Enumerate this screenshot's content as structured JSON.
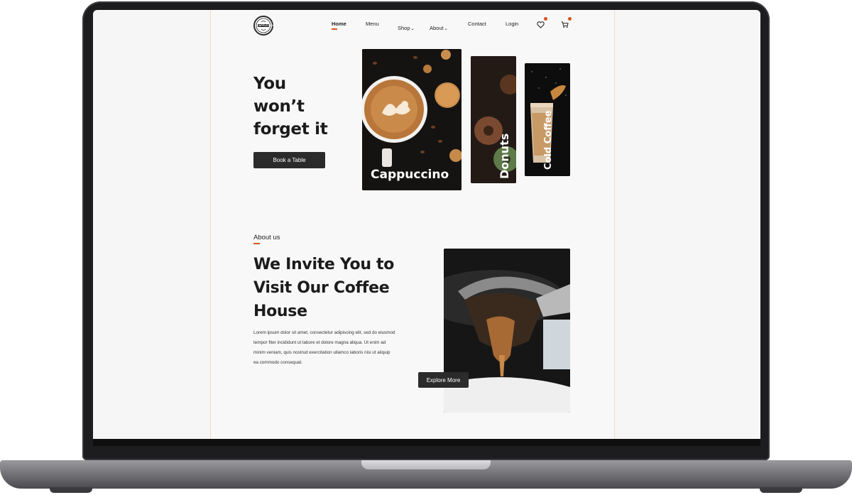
{
  "logo": {
    "text": "CAPPUCCINO"
  },
  "nav": {
    "items": [
      {
        "label": "Home",
        "active": true
      },
      {
        "label": "Menu"
      },
      {
        "label": "Shop"
      },
      {
        "label": "About"
      },
      {
        "label": "Contact"
      },
      {
        "label": "Login"
      }
    ],
    "wishlist_icon": "heart-icon",
    "cart_icon": "cart-icon"
  },
  "hero": {
    "title_lines": [
      "You",
      "won’t",
      "forget it"
    ],
    "cta": "Book a Table",
    "cards": [
      {
        "label": "Cappuccino"
      },
      {
        "label": "Donuts"
      },
      {
        "label": "Cold Coffee"
      }
    ]
  },
  "about": {
    "kicker": "About us",
    "title_lines": [
      "We Invite You to",
      "Visit Our Coffee",
      "House"
    ],
    "body_lines": [
      "Lorem ipsum dolor sit amet, consectetur adipiscing elit, sed do eiusmod",
      "tempor fiter incididunt ut labore et dolore magna aliqua. Ut enim ad",
      "minim veniam, quis nostrud exercitation ullamco laboris nisi ut aliquip",
      "ea commodo consequat."
    ],
    "cta": "Explore More"
  },
  "colors": {
    "accent": "#d9531e",
    "dark": "#2b2b2b",
    "background": "#f8f8f8"
  }
}
